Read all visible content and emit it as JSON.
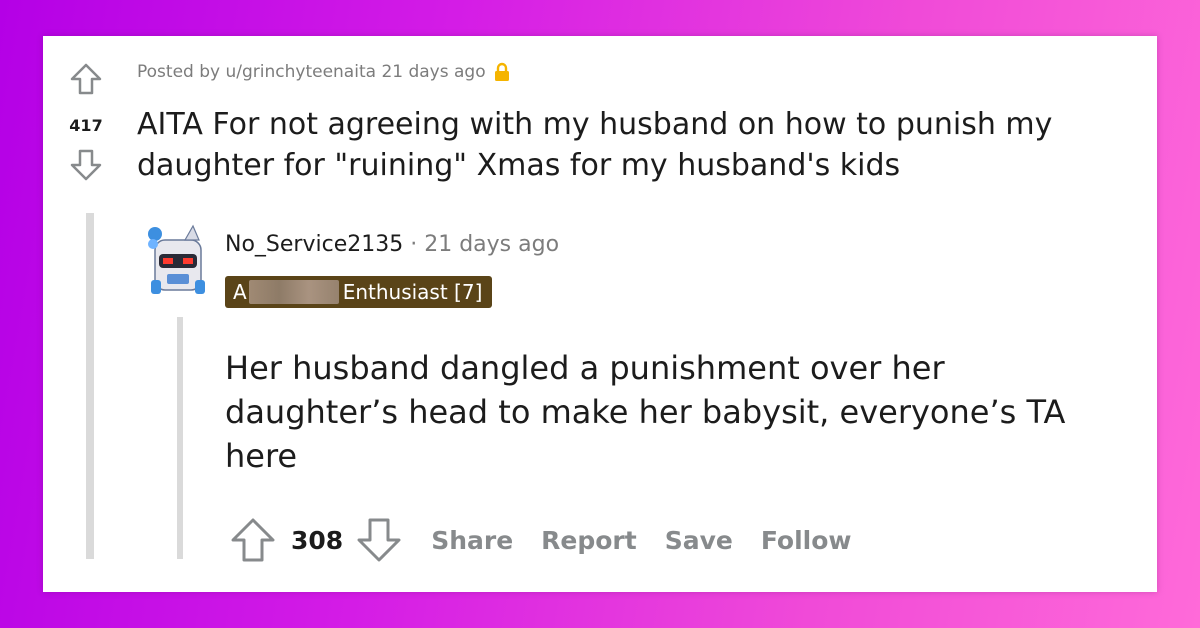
{
  "post": {
    "vote_count": "417",
    "posted_by_prefix": "Posted by",
    "author": "u/grinchyteenaita",
    "time": "21 days ago",
    "title": "AITA For not agreeing with my husband on how to punish my daughter for \"ruining\" Xmas for my husband's kids",
    "lock_icon": "lock-icon"
  },
  "comment": {
    "username": "No_Service2135",
    "separator": "·",
    "time": "21 days ago",
    "flair_prefix": "A",
    "flair_suffix": "Enthusiast [7]",
    "body": "Her husband dangled a punishment over her daughter’s head to make her babysit, everyone’s TA here",
    "score": "308",
    "actions": {
      "share": "Share",
      "report": "Report",
      "save": "Save",
      "follow": "Follow"
    }
  },
  "colors": {
    "background_left": "#b400e6",
    "background_right": "#ff6ad9",
    "flair_bg": "#5a4418",
    "muted_text": "#7c7c7c",
    "action_text": "#878a8c",
    "lock": "#f5b400"
  },
  "icons": {
    "upvote": "upvote-arrow-icon",
    "downvote": "downvote-arrow-icon",
    "avatar": "robot-snoo-avatar"
  }
}
